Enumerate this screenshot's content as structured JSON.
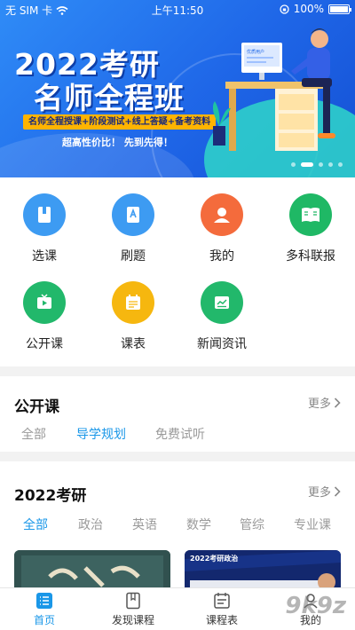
{
  "status_bar": {
    "carrier": "无 SIM 卡",
    "time": "上午11:50",
    "battery": "100%",
    "battery_level": 1.0
  },
  "banner": {
    "title_line1": "2022考研",
    "title_line2": "名师全程班",
    "subtitle": "名师全程授课+阶段测试+线上答疑+备考资料",
    "slogan": "超高性价比！ 先到先得！",
    "screen_text": "优质用户",
    "slides": 5,
    "active_slide": 1
  },
  "menu": [
    {
      "label": "选课",
      "icon": "book-icon",
      "color": "#3d9bf2"
    },
    {
      "label": "刷题",
      "icon": "exam-paper-icon",
      "color": "#3d9bf2"
    },
    {
      "label": "我的",
      "icon": "user-icon",
      "color": "#f46b3c"
    },
    {
      "label": "多科联报",
      "icon": "open-book-icon",
      "color": "#1fb865"
    },
    {
      "label": "公开课",
      "icon": "tv-play-icon",
      "color": "#22b86b"
    },
    {
      "label": "课表",
      "icon": "schedule-icon",
      "color": "#f6b70f"
    },
    {
      "label": "新闻资讯",
      "icon": "news-icon",
      "color": "#22b86b"
    }
  ],
  "open_course": {
    "title": "公开课",
    "more": "更多",
    "tabs": [
      "全部",
      "导学规划",
      "免费试听"
    ],
    "active_tab": 1
  },
  "kaoyan": {
    "title": "2022考研",
    "more": "更多",
    "tabs": [
      "全部",
      "政治",
      "英语",
      "数学",
      "管综",
      "专业课"
    ],
    "active_tab": 0,
    "card2_label": "2022考研政治"
  },
  "bottom_nav": [
    {
      "label": "首页",
      "icon": "home-list-icon",
      "active": true
    },
    {
      "label": "发现课程",
      "icon": "bookmark-book-icon",
      "active": false
    },
    {
      "label": "课程表",
      "icon": "calendar-icon",
      "active": false
    },
    {
      "label": "我的",
      "icon": "person-icon",
      "active": false
    }
  ],
  "watermark": "9k9z",
  "colors": {
    "accent": "#1a97e8",
    "banner_blue": "#1f67e8",
    "banner_yellow": "#ffb400"
  }
}
